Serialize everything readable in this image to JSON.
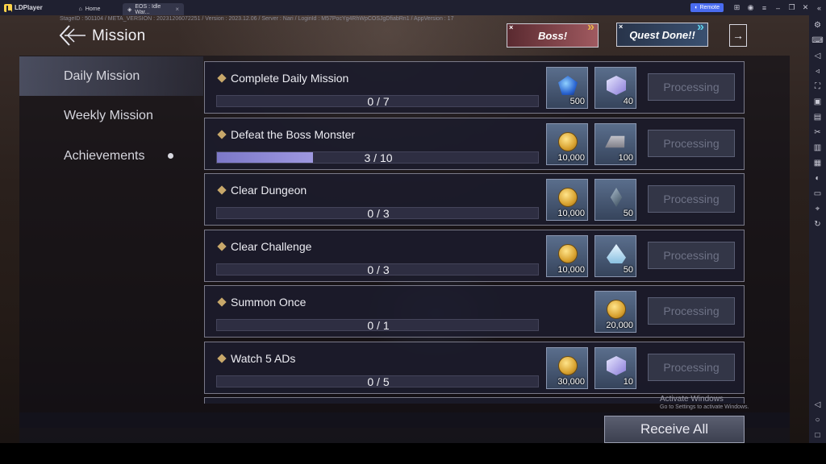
{
  "titlebar": {
    "app_name": "LDPlayer",
    "tabs": [
      {
        "label": "Home"
      },
      {
        "label": "EOS : Idle War...",
        "close": "×"
      }
    ],
    "remote_label": "Remote",
    "icons": [
      "gamepad-icon",
      "user-icon",
      "menu-icon",
      "minimize-icon",
      "restore-icon",
      "close-icon",
      "collapse-icon"
    ]
  },
  "debug_info": "StageID : 501104 / META_VERSION : 20231206072251 / Version : 2023.12.06 / Server : Nari / LoginId : M57PocYg4RhWpCOSJgDfiabRn1 / AppVersion : 17",
  "header": {
    "title": "Mission",
    "boss_banner": "Boss!",
    "quest_banner": "Quest Done!!",
    "banner_close": "×"
  },
  "categories": [
    {
      "label": "Daily Mission",
      "active": true
    },
    {
      "label": "Weekly Mission",
      "active": false
    },
    {
      "label": "Achievements",
      "active": false,
      "notification": true
    }
  ],
  "missions": [
    {
      "title": "Complete Daily Mission",
      "progress": "0 / 7",
      "current": 0,
      "total": 7,
      "rewards": [
        {
          "icon": "blue-gem-icon",
          "amount": "500"
        },
        {
          "icon": "summon-ticket-icon",
          "amount": "40"
        }
      ],
      "button": "Processing"
    },
    {
      "title": "Defeat the Boss Monster",
      "progress": "3 / 10",
      "current": 3,
      "total": 10,
      "rewards": [
        {
          "icon": "gold-coin-icon",
          "amount": "10,000"
        },
        {
          "icon": "iron-ingot-icon",
          "amount": "100"
        }
      ],
      "button": "Processing"
    },
    {
      "title": "Clear Dungeon",
      "progress": "0 / 3",
      "current": 0,
      "total": 3,
      "rewards": [
        {
          "icon": "gold-coin-icon",
          "amount": "10,000"
        },
        {
          "icon": "dark-crystal-icon",
          "amount": "50"
        }
      ],
      "button": "Processing"
    },
    {
      "title": "Clear Challenge",
      "progress": "0 / 3",
      "current": 0,
      "total": 3,
      "rewards": [
        {
          "icon": "gold-coin-icon",
          "amount": "10,000"
        },
        {
          "icon": "ice-shard-icon",
          "amount": "50"
        }
      ],
      "button": "Processing"
    },
    {
      "title": "Summon Once",
      "progress": "0 / 1",
      "current": 0,
      "total": 1,
      "rewards": [
        {
          "icon": "gold-coin-icon",
          "amount": "20,000"
        }
      ],
      "button": "Processing"
    },
    {
      "title": "Watch 5 ADs",
      "progress": "0 / 5",
      "current": 0,
      "total": 5,
      "rewards": [
        {
          "icon": "gold-coin-icon",
          "amount": "30,000"
        },
        {
          "icon": "summon-ticket-icon",
          "amount": "10"
        }
      ],
      "button": "Processing"
    }
  ],
  "receive_all": "Receive All",
  "watermark": {
    "line1": "Activate Windows",
    "line2": "Go to Settings to activate Windows."
  },
  "colors": {
    "accent_progress": "#8e88d8",
    "title_bar": "#1f2030",
    "remote_button": "#4a6cf0"
  }
}
